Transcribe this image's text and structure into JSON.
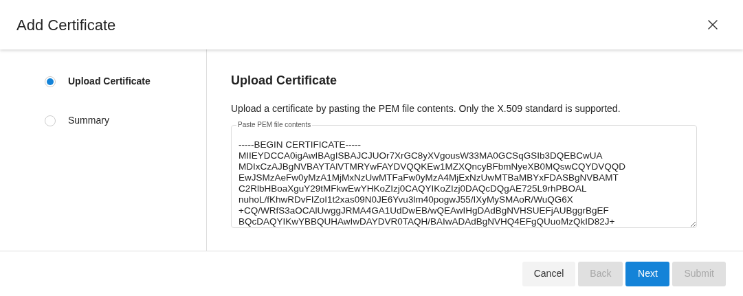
{
  "dialog": {
    "title": "Add Certificate"
  },
  "steps": [
    {
      "label": "Upload Certificate",
      "selected": true
    },
    {
      "label": "Summary",
      "selected": false
    }
  ],
  "section": {
    "heading": "Upload Certificate",
    "description": "Upload a certificate by pasting the PEM file contents. Only the X.509 standard is supported.",
    "field": {
      "label": "Paste PEM file contents",
      "value": "-----BEGIN CERTIFICATE-----\nMIIEYDCCA0igAwIBAgISBAJCJUOr7XrGC8yXVgousW33MA0GCSqGSIb3DQEBCwUA\nMDIxCzAJBgNVBAYTAlVTMRYwFAYDVQQKEw1MZXQncyBFbmNyeXB0MQswCQYDVQQD\nEwJSMzAeFw0yMzA1MjMxNzUwMTFaFw0yMzA4MjExNzUwMTBaMBYxFDASBgNVBAMT\nC2RlbHBoaXguY29tMFkwEwYHKoZIzj0CAQYIKoZIzj0DAQcDQgAE725L9rhPBOAL\nnuhoL/fKhwRDvFIZoI1t2xas09N0JE6Yvu3lm40pogwJ55/IXyMySMAoR/WuQG6X\n+CQ/WRfS3aOCAlUwggJRMA4GA1UdDwEB/wQEAwIHgDAdBgNVHSUEFjAUBggrBgEF\nBQcDAQYIKwYBBQUHAwIwDAYDVR0TAQH/BAIwADAdBgNVHQ4EFgQUuoMzQkID82J+"
    }
  },
  "buttons": [
    {
      "label": "Cancel",
      "kind": "secondary",
      "disabled": false
    },
    {
      "label": "Back",
      "kind": "secondary",
      "disabled": true
    },
    {
      "label": "Next",
      "kind": "primary",
      "disabled": false
    },
    {
      "label": "Submit",
      "kind": "primary",
      "disabled": true
    }
  ]
}
